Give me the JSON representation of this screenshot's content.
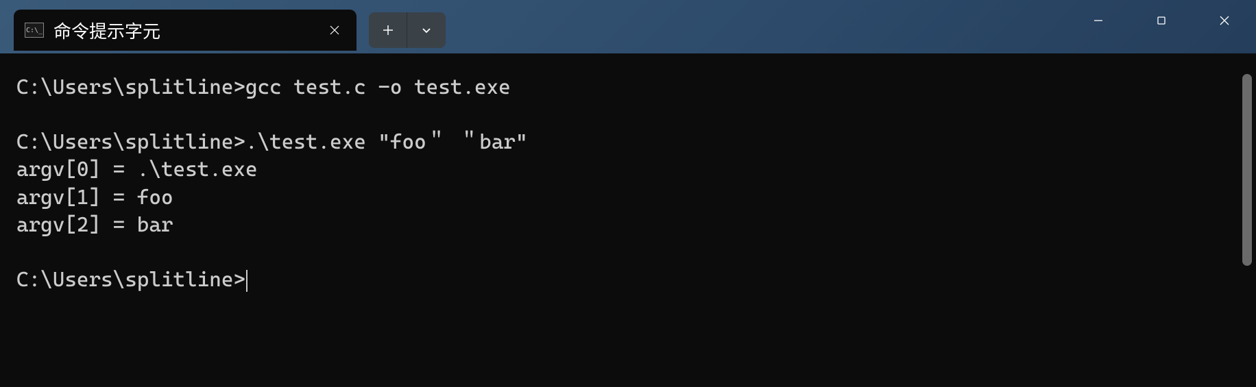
{
  "window": {
    "tab_title": "命令提示字元",
    "tab_icon_text": "C:\\_"
  },
  "terminal": {
    "lines": [
      "C:\\Users\\splitline>gcc test.c -o test.exe",
      "",
      "C:\\Users\\splitline>.\\test.exe \"foo＂ ＂bar\"",
      "argv[0] = .\\test.exe",
      "argv[1] = foo",
      "argv[2] = bar",
      "",
      "C:\\Users\\splitline>"
    ],
    "prompt": "C:\\Users\\splitline>",
    "commands": [
      "gcc test.c -o test.exe",
      ".\\test.exe \"foo＂ ＂bar\""
    ],
    "output": [
      "argv[0] = .\\test.exe",
      "argv[1] = foo",
      "argv[2] = bar"
    ]
  }
}
